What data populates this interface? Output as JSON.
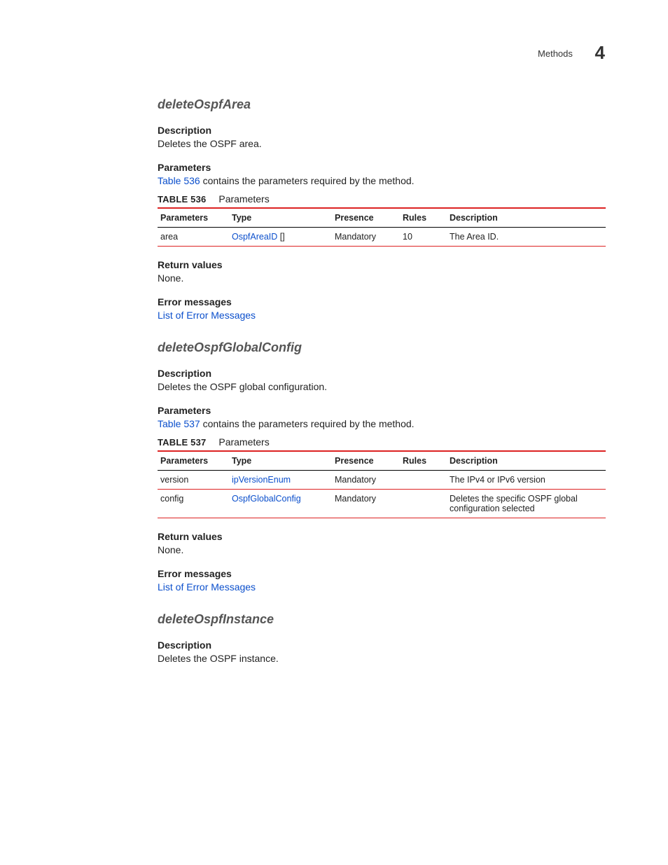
{
  "header": {
    "section": "Methods",
    "chapter": "4"
  },
  "s1": {
    "title": "deleteOspfArea",
    "desc_h": "Description",
    "desc": "Deletes the OSPF area.",
    "param_h": "Parameters",
    "param_lead_a": "Table 536",
    "param_lead_b": " contains the parameters required by the method.",
    "table_label": "TABLE 536",
    "table_caption": "Parameters",
    "th": {
      "p": "Parameters",
      "t": "Type",
      "pr": "Presence",
      "r": "Rules",
      "d": "Description"
    },
    "rows": [
      {
        "p": "area",
        "t": "OspfAreaID",
        "tsuffix": " []",
        "pr": "Mandatory",
        "r": "10",
        "d": "The Area ID."
      }
    ],
    "rv_h": "Return values",
    "rv": "None.",
    "err_h": "Error messages",
    "err_link": "List of Error Messages"
  },
  "s2": {
    "title": "deleteOspfGlobalConfig",
    "desc_h": "Description",
    "desc": "Deletes the OSPF global configuration.",
    "param_h": "Parameters",
    "param_lead_a": "Table 537",
    "param_lead_b": " contains the parameters required by the method.",
    "table_label": "TABLE 537",
    "table_caption": "Parameters",
    "th": {
      "p": "Parameters",
      "t": "Type",
      "pr": "Presence",
      "r": "Rules",
      "d": "Description"
    },
    "rows": [
      {
        "p": "version",
        "t": "ipVersionEnum",
        "tsuffix": "",
        "pr": "Mandatory",
        "r": "",
        "d": "The IPv4 or IPv6 version"
      },
      {
        "p": "config",
        "t": "OspfGlobalConfig",
        "tsuffix": "",
        "pr": "Mandatory",
        "r": "",
        "d": "Deletes the specific OSPF global configuration selected"
      }
    ],
    "rv_h": "Return values",
    "rv": "None.",
    "err_h": "Error messages",
    "err_link": "List of Error Messages"
  },
  "s3": {
    "title": "deleteOspfInstance",
    "desc_h": "Description",
    "desc": "Deletes the OSPF instance."
  }
}
